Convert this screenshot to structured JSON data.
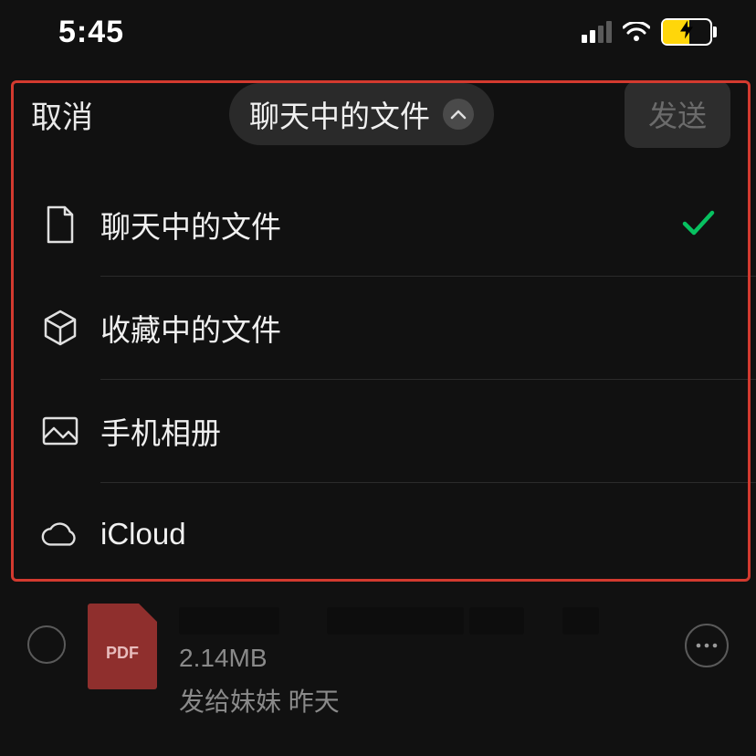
{
  "status": {
    "time": "5:45"
  },
  "nav": {
    "cancel": "取消",
    "title": "聊天中的文件",
    "send": "发送"
  },
  "dropdown": {
    "items": [
      {
        "label": "聊天中的文件",
        "icon": "file-icon",
        "selected": true
      },
      {
        "label": "收藏中的文件",
        "icon": "cube-icon",
        "selected": false
      },
      {
        "label": "手机相册",
        "icon": "photo-icon",
        "selected": false
      },
      {
        "label": "iCloud",
        "icon": "cloud-icon",
        "selected": false
      }
    ]
  },
  "file": {
    "thumb_label": "PDF",
    "size": "2.14MB",
    "sent_to_prefix": "发给妹妹",
    "sent_when": "昨天"
  }
}
